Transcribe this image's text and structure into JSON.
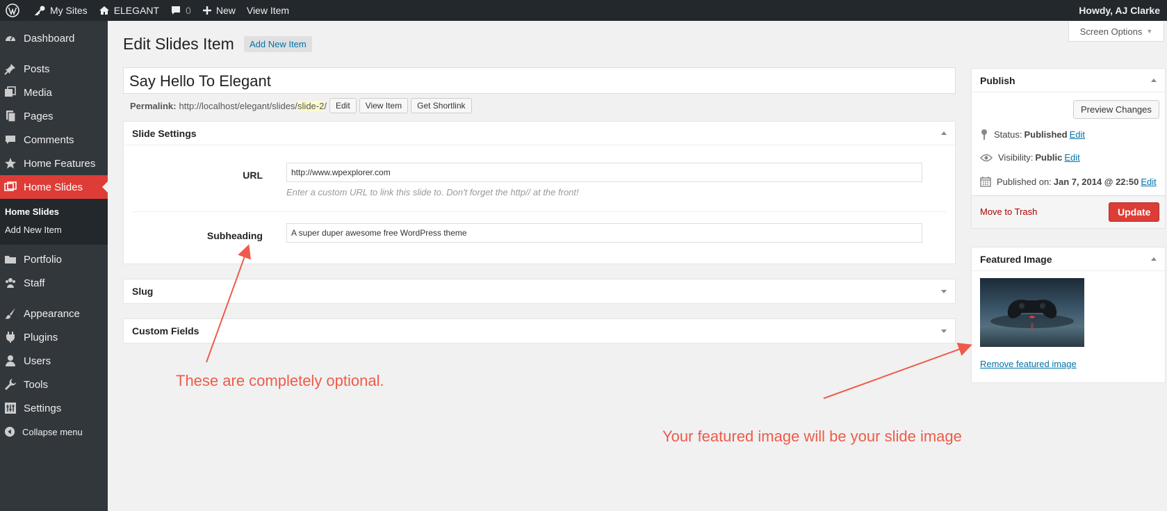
{
  "admin_bar": {
    "my_sites": "My Sites",
    "site_name": "ELEGANT",
    "comments_count": "0",
    "new_label": "New",
    "view_item": "View Item",
    "howdy": "Howdy, AJ Clarke"
  },
  "sidebar": {
    "items": [
      {
        "label": "Dashboard",
        "icon": "dashboard-icon"
      },
      {
        "label": "Posts",
        "icon": "pin-icon"
      },
      {
        "label": "Media",
        "icon": "media-icon"
      },
      {
        "label": "Pages",
        "icon": "pages-icon"
      },
      {
        "label": "Comments",
        "icon": "comment-icon"
      },
      {
        "label": "Home Features",
        "icon": "star-icon"
      },
      {
        "label": "Home Slides",
        "icon": "slides-icon"
      },
      {
        "label": "Portfolio",
        "icon": "folder-icon"
      },
      {
        "label": "Staff",
        "icon": "staff-icon"
      },
      {
        "label": "Appearance",
        "icon": "brush-icon"
      },
      {
        "label": "Plugins",
        "icon": "plug-icon"
      },
      {
        "label": "Users",
        "icon": "user-icon"
      },
      {
        "label": "Tools",
        "icon": "wrench-icon"
      },
      {
        "label": "Settings",
        "icon": "settings-icon"
      }
    ],
    "submenu": [
      "Home Slides",
      "Add New Item"
    ],
    "collapse": "Collapse menu"
  },
  "screen_options": "Screen Options",
  "header": {
    "title": "Edit Slides Item",
    "add_new": "Add New Item"
  },
  "post": {
    "title": "Say Hello To Elegant",
    "permalink_label": "Permalink:",
    "permalink_base": "http://localhost/elegant/slides/",
    "permalink_slug": "slide-2",
    "permalink_end": "/",
    "edit_btn": "Edit",
    "view_btn": "View Item",
    "shortlink_btn": "Get Shortlink"
  },
  "slide_settings": {
    "title": "Slide Settings",
    "url_label": "URL",
    "url_value": "http://www.wpexplorer.com",
    "url_desc": "Enter a custom URL to link this slide to. Don't forget the http// at the front!",
    "subheading_label": "Subheading",
    "subheading_value": "A super duper awesome free WordPress theme"
  },
  "slug_box": "Slug",
  "custom_fields_box": "Custom Fields",
  "publish": {
    "title": "Publish",
    "preview": "Preview Changes",
    "status_label": "Status:",
    "status_value": "Published",
    "visibility_label": "Visibility:",
    "visibility_value": "Public",
    "published_label": "Published on:",
    "published_value": "Jan 7, 2014 @ 22:50",
    "edit": "Edit",
    "trash": "Move to Trash",
    "update": "Update"
  },
  "featured_image": {
    "title": "Featured Image",
    "remove": "Remove featured image"
  },
  "annotations": {
    "optional": "These are completely optional.",
    "featured": "Your featured image will be your slide image"
  },
  "colors": {
    "accent": "#dd3d36",
    "annotation": "#ee5b4a",
    "link": "#0073aa"
  }
}
